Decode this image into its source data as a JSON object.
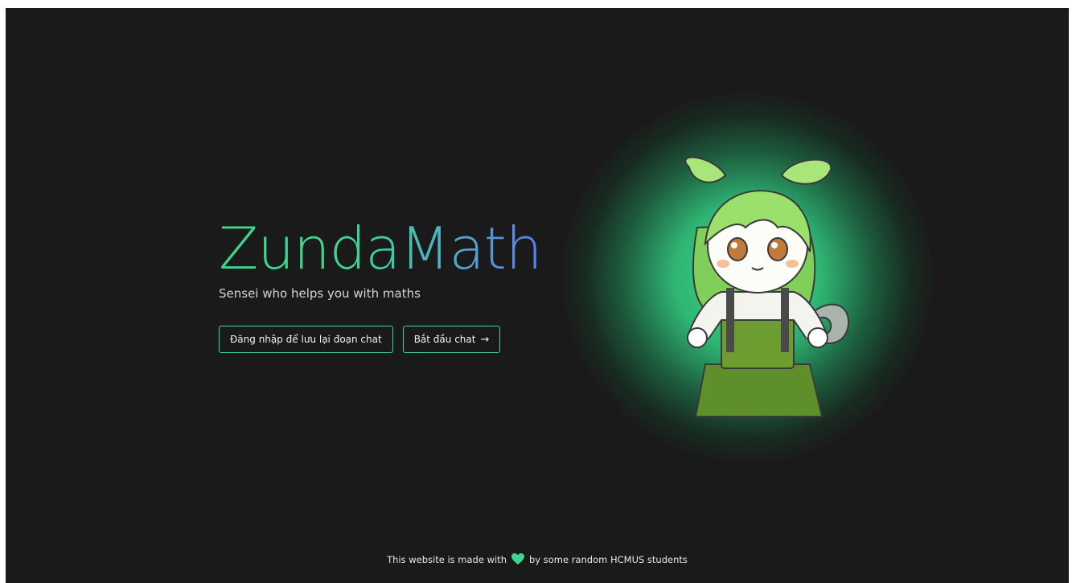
{
  "hero": {
    "title": "ZundaMath",
    "subtitle": "Sensei who helps you with maths"
  },
  "buttons": {
    "login_label": "Đăng nhập để lưu lại đoạn chat",
    "start_label": "Bắt đầu chat",
    "start_icon": "arrow-right-icon"
  },
  "footer": {
    "prefix": "This website is made with",
    "icon": "heart-icon",
    "suffix": "by some random HCMUS students"
  },
  "colors": {
    "background": "#1a1a1a",
    "accent": "#3dd68c",
    "gradient_end": "#5b7cf0"
  }
}
